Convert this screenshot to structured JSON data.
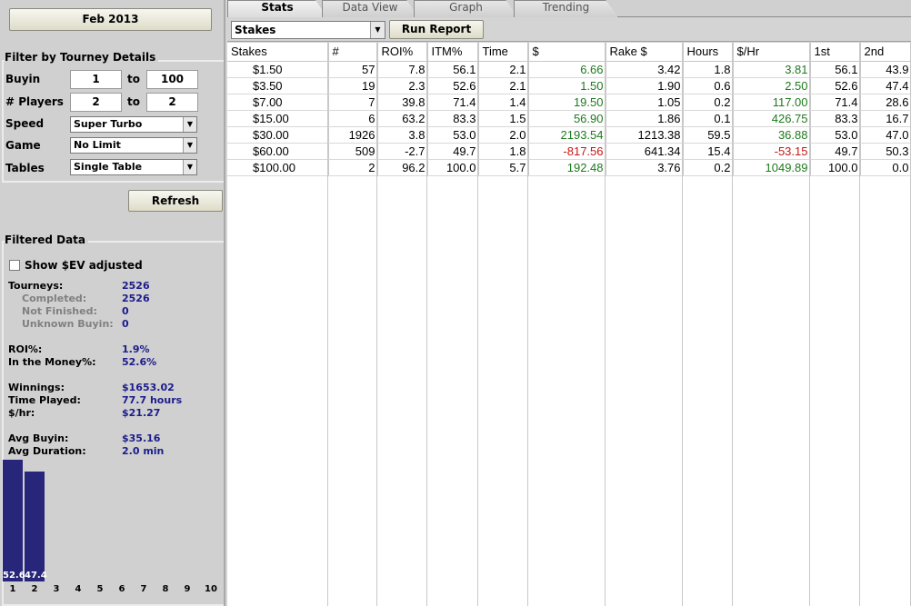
{
  "left": {
    "date_button": "Feb 2013",
    "filter_title": "Filter by Tourney Details",
    "buyin": {
      "label": "Buyin",
      "from": "1",
      "to_label": "to",
      "to": "100"
    },
    "players": {
      "label": "# Players",
      "from": "2",
      "to_label": "to",
      "to": "2"
    },
    "speed": {
      "label": "Speed",
      "value": "Super Turbo"
    },
    "game": {
      "label": "Game",
      "value": "No Limit"
    },
    "tables": {
      "label": "Tables",
      "value": "Single Table"
    },
    "refresh_label": "Refresh",
    "filtered_title": "Filtered Data",
    "show_ev_label": "Show $EV adjusted",
    "show_ev_checked": false,
    "stats": {
      "tourneys": {
        "label": "Tourneys:",
        "value": "2526"
      },
      "completed": {
        "label": "Completed:",
        "value": "2526"
      },
      "not_finished": {
        "label": "Not Finished:",
        "value": "0"
      },
      "unknown_buyin": {
        "label": "Unknown Buyin:",
        "value": "0"
      },
      "roi": {
        "label": "ROI%:",
        "value": "1.9%"
      },
      "itm": {
        "label": "In the Money%:",
        "value": "52.6%"
      },
      "winnings": {
        "label": "Winnings:",
        "value": "$1653.02"
      },
      "time_played": {
        "label": "Time Played:",
        "value": "77.7 hours"
      },
      "per_hr": {
        "label": "$/hr:",
        "value": "$21.27"
      },
      "avg_buyin": {
        "label": "Avg Buyin:",
        "value": "$35.16"
      },
      "avg_duration": {
        "label": "Avg Duration:",
        "value": "2.0 min"
      }
    }
  },
  "chart_data": {
    "type": "bar",
    "categories": [
      "1",
      "2",
      "3",
      "4",
      "5",
      "6",
      "7",
      "8",
      "9",
      "10"
    ],
    "values": [
      52.6,
      47.4,
      0,
      0,
      0,
      0,
      0,
      0,
      0,
      0
    ],
    "value_labels": [
      "52.6",
      "47.4"
    ],
    "ylim": [
      0,
      100
    ],
    "bar_color": "#28267a"
  },
  "tabs": [
    {
      "label": "Stats",
      "active": true
    },
    {
      "label": "Data View",
      "active": false
    },
    {
      "label": "Graph",
      "active": false
    },
    {
      "label": "Trending",
      "active": false
    }
  ],
  "toolbar": {
    "group_by": "Stakes",
    "run_report_label": "Run Report"
  },
  "table": {
    "columns": [
      "Stakes",
      "#",
      "ROI%",
      "ITM%",
      "Time",
      "$",
      "Rake $",
      "Hours",
      "$/Hr",
      "1st",
      "2nd"
    ],
    "rows": [
      [
        "$1.50",
        "57",
        "7.8",
        "56.1",
        "2.1",
        "6.66",
        "3.42",
        "1.8",
        "3.81",
        "56.1",
        "43.9"
      ],
      [
        "$3.50",
        "19",
        "2.3",
        "52.6",
        "2.1",
        "1.50",
        "1.90",
        "0.6",
        "2.50",
        "52.6",
        "47.4"
      ],
      [
        "$7.00",
        "7",
        "39.8",
        "71.4",
        "1.4",
        "19.50",
        "1.05",
        "0.2",
        "117.00",
        "71.4",
        "28.6"
      ],
      [
        "$15.00",
        "6",
        "63.2",
        "83.3",
        "1.5",
        "56.90",
        "1.86",
        "0.1",
        "426.75",
        "83.3",
        "16.7"
      ],
      [
        "$30.00",
        "1926",
        "3.8",
        "53.0",
        "2.0",
        "2193.54",
        "1213.38",
        "59.5",
        "36.88",
        "53.0",
        "47.0"
      ],
      [
        "$60.00",
        "509",
        "-2.7",
        "49.7",
        "1.8",
        "-817.56",
        "641.34",
        "15.4",
        "-53.15",
        "49.7",
        "50.3"
      ],
      [
        "$100.00",
        "2",
        "96.2",
        "100.0",
        "5.7",
        "192.48",
        "3.76",
        "0.2",
        "1049.89",
        "100.0",
        "0.0"
      ]
    ]
  },
  "colors": {
    "positive": "#1e7a1e",
    "negative": "#c81414",
    "stat_value": "#1c1c8c"
  }
}
